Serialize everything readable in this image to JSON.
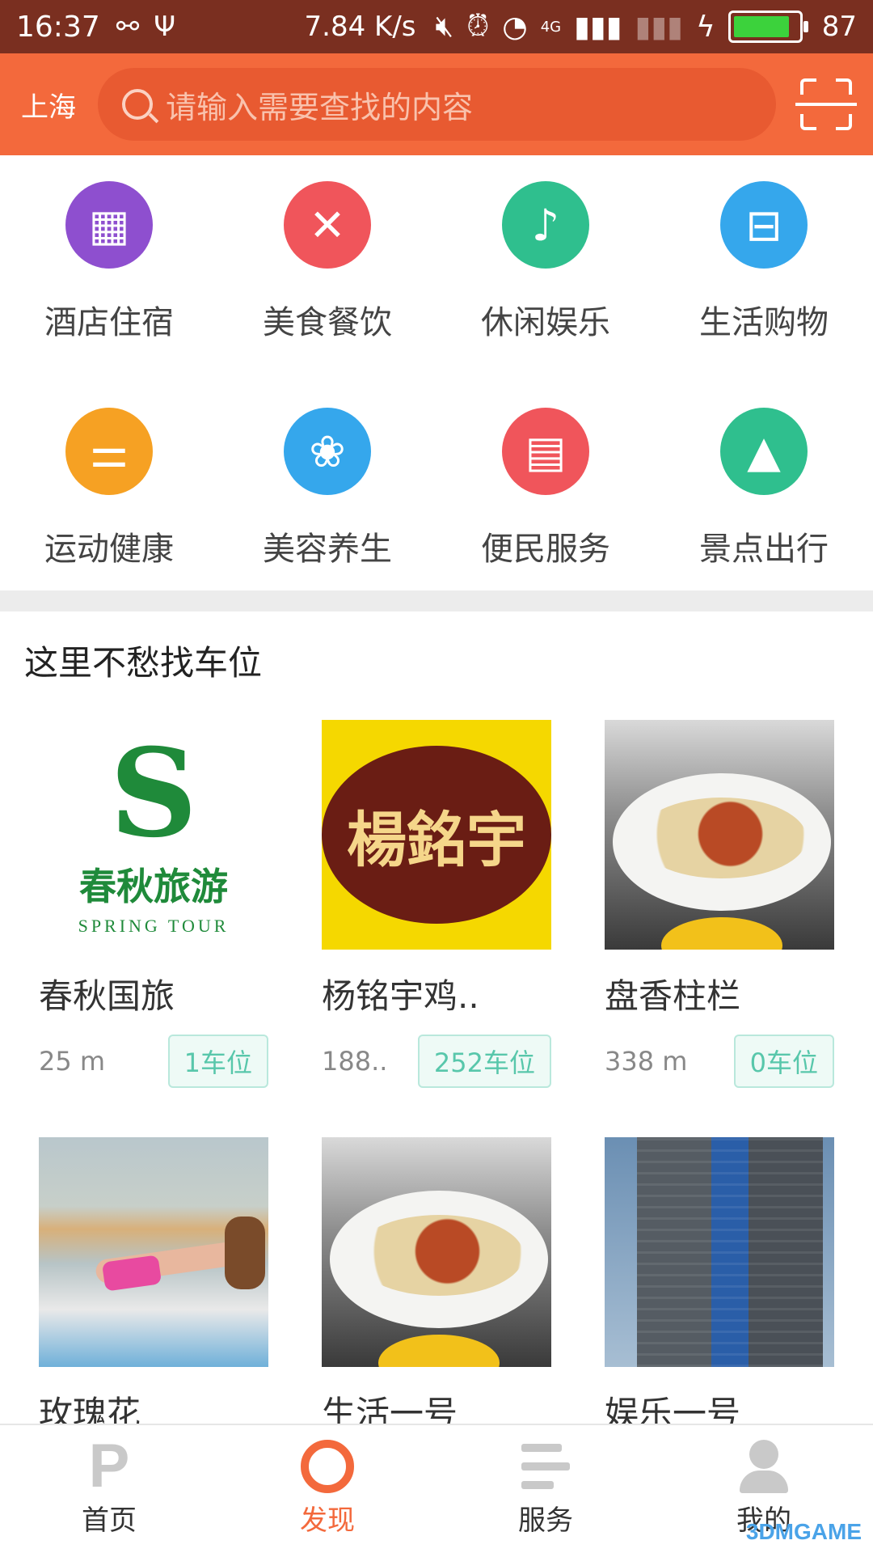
{
  "status_bar": {
    "time": "16:37",
    "speed": "7.84 K/s",
    "network": "4G",
    "battery": "87",
    "battery_level": 0.87
  },
  "header": {
    "city": "上海",
    "search_placeholder": "请输入需要查找的内容"
  },
  "categories": [
    {
      "label": "酒店住宿",
      "icon": "hotel-icon",
      "color": "#8e4fcf"
    },
    {
      "label": "美食餐饮",
      "icon": "food-icon",
      "color": "#f0555b"
    },
    {
      "label": "休闲娱乐",
      "icon": "music-icon",
      "color": "#2fbf8e"
    },
    {
      "label": "生活购物",
      "icon": "basket-icon",
      "color": "#35a7ec"
    },
    {
      "label": "运动健康",
      "icon": "dumbbell-icon",
      "color": "#f6a123"
    },
    {
      "label": "美容养生",
      "icon": "lotus-icon",
      "color": "#35a7ec"
    },
    {
      "label": "便民服务",
      "icon": "card-icon",
      "color": "#f0555b"
    },
    {
      "label": "景点出行",
      "icon": "mountain-icon",
      "color": "#2fbf8e"
    }
  ],
  "section": {
    "title": "这里不愁找车位"
  },
  "places": [
    {
      "name": "春秋国旅",
      "distance": "25 m",
      "spots": "1车位",
      "thumb": {
        "big": "S",
        "cn": "春秋旅游",
        "en": "SPRING TOUR"
      }
    },
    {
      "name": "杨铭宇鸡..",
      "distance": "188..",
      "spots": "252车位",
      "thumb": {
        "text": "楊銘宇"
      }
    },
    {
      "name": "盘香柱栏",
      "distance": "338 m",
      "spots": "0车位"
    },
    {
      "name": "玫瑰花"
    },
    {
      "name": "生活一号"
    },
    {
      "name": "娱乐一号"
    }
  ],
  "bottom_nav": [
    {
      "label": "首页",
      "icon": "parking-icon"
    },
    {
      "label": "发现",
      "icon": "discover-icon",
      "active": true
    },
    {
      "label": "服务",
      "icon": "service-icon"
    },
    {
      "label": "我的",
      "icon": "profile-icon"
    }
  ],
  "watermark": "3DMGAME"
}
